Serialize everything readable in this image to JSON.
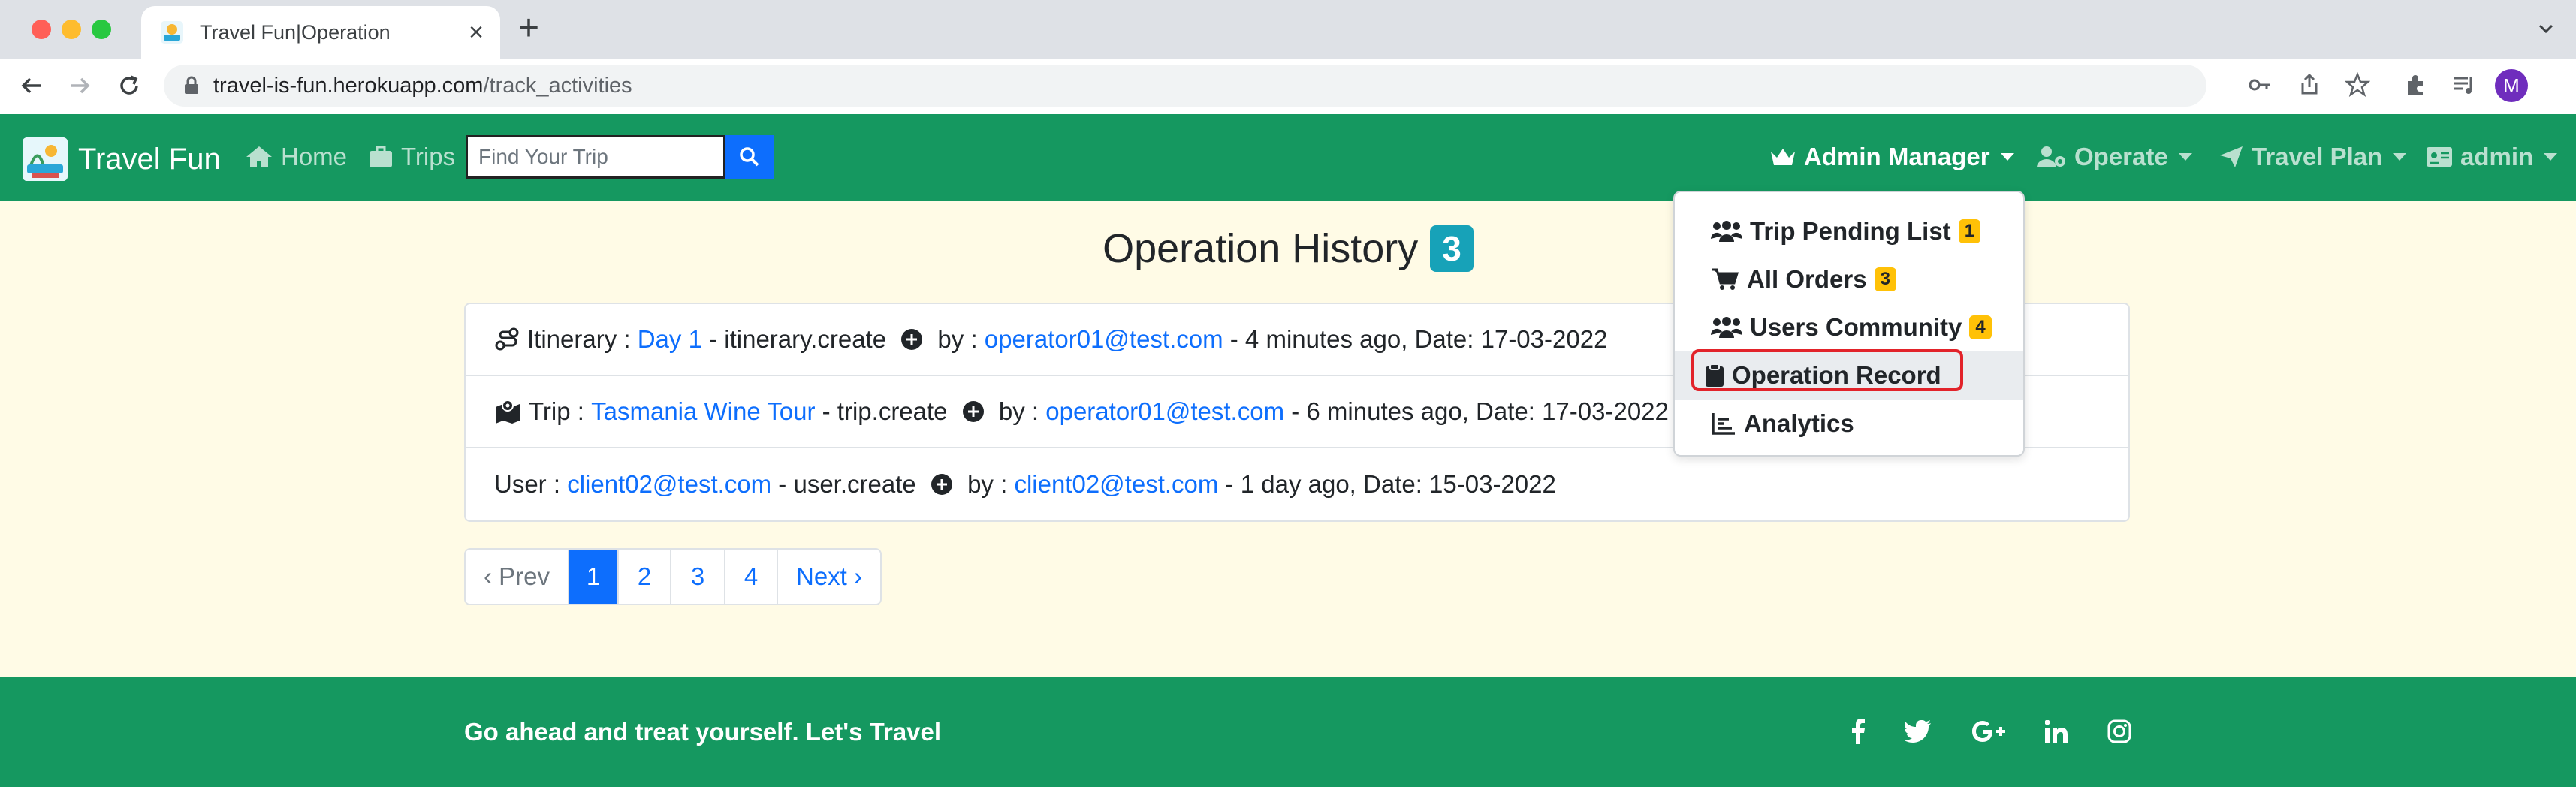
{
  "browser": {
    "tab_title": "Travel Fun|Operation",
    "url_host": "travel-is-fun.herokuapp.com",
    "url_path": "/track_activities",
    "profile_initial": "M"
  },
  "navbar": {
    "brand": "Travel Fun",
    "home": "Home",
    "trips": "Trips",
    "search_placeholder": "Find Your Trip",
    "admin_manager": "Admin Manager",
    "operate": "Operate",
    "travel_plan": "Travel Plan",
    "user": "admin"
  },
  "main": {
    "title": "Operation History",
    "count": "3",
    "items": [
      {
        "label": "Itinerary : ",
        "target": "Day 1",
        "action": " - itinerary.create ",
        "by": " by : ",
        "email": "operator01@test.com",
        "time": " - 4 minutes ago, Date: 17-03-2022"
      },
      {
        "label": "Trip : ",
        "target": "Tasmania Wine Tour",
        "action": " - trip.create ",
        "by": " by : ",
        "email": "operator01@test.com",
        "time": " - 6 minutes ago, Date: 17-03-2022"
      },
      {
        "label": "User : ",
        "target": "client02@test.com",
        "action": " - user.create ",
        "by": " by : ",
        "email": "client02@test.com",
        "time": " - 1 day ago, Date: 15-03-2022"
      }
    ],
    "pagination": {
      "prev": "‹ Prev",
      "pages": [
        "1",
        "2",
        "3",
        "4"
      ],
      "current": "1",
      "next": "Next ›"
    }
  },
  "dropdown": {
    "items": [
      {
        "label": "Trip Pending List",
        "badge": "1",
        "icon": "users-icon"
      },
      {
        "label": "All Orders",
        "badge": "3",
        "icon": "cart-icon"
      },
      {
        "label": "Users Community",
        "badge": "4",
        "icon": "users-icon"
      },
      {
        "label": "Operation Record",
        "badge": "",
        "icon": "clipboard-icon"
      },
      {
        "label": "Analytics",
        "badge": "",
        "icon": "chart-icon"
      }
    ],
    "active": "Operation Record"
  },
  "footer": {
    "tagline": "Go ahead and treat yourself. Let's Travel",
    "social": [
      "facebook-icon",
      "twitter-icon",
      "google-plus-icon",
      "linkedin-icon",
      "instagram-icon"
    ]
  },
  "colors": {
    "navbar": "#159860",
    "main_bg": "#fffbe6",
    "link": "#0d6efd",
    "badge_info": "#17a2b8",
    "badge_warning": "#ffc107",
    "highlight": "#e2232a"
  }
}
